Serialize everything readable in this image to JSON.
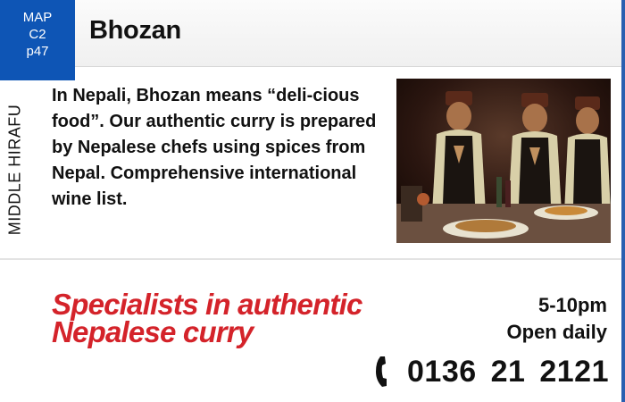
{
  "map_badge": {
    "line1": "MAP",
    "line2": "C2",
    "line3": "p47"
  },
  "title": "Bhozan",
  "area_label": "MIDDLE HIRAFU",
  "description": "In Nepali, Bhozan means “deli-cious food”. Our authentic curry is prepared by Nepalese chefs using spices from Nepal. Comprehensive international wine list.",
  "tagline": {
    "line1": "Specialists in authentic",
    "line2": "Nepalese curry"
  },
  "hours": {
    "line1": "5-10pm",
    "line2": "Open daily"
  },
  "phone": {
    "icon": "phone-icon",
    "number": "0136 21 2121"
  },
  "colors": {
    "badge": "#0e55b5",
    "tagline": "#d4232a",
    "edge": "#2a5fb0"
  }
}
